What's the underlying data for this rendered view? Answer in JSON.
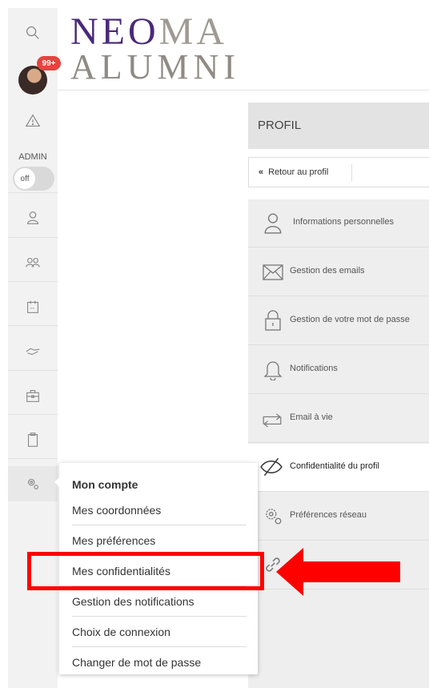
{
  "logo": {
    "line1_purple": "NE",
    "line1_o": "O",
    "line1_gray": "MA",
    "line2": "ALUMNI"
  },
  "rail": {
    "badge": "99+",
    "admin_label": "ADMIN",
    "toggle_state": "off",
    "icons": [
      "search-icon",
      "warning-icon",
      "user-icon",
      "group-icon",
      "calendar-icon",
      "handshake-icon",
      "briefcase-icon",
      "clipboard-icon",
      "settings-icon"
    ]
  },
  "profile": {
    "title": "PROFIL",
    "back_label": "Retour au profil",
    "menu": [
      {
        "label": "Informations personnelles",
        "icon": "user-icon"
      },
      {
        "label": "Gestion des emails",
        "icon": "envelope-icon"
      },
      {
        "label": "Gestion de votre mot de passe",
        "icon": "lock-icon"
      },
      {
        "label": "Notifications",
        "icon": "bell-icon"
      },
      {
        "label": "Email à vie",
        "icon": "forward-icon"
      },
      {
        "label": "Confidentialité du profil",
        "icon": "eye-slash-icon",
        "active": true
      },
      {
        "label": "Préférences réseau",
        "icon": "gear-icon"
      },
      {
        "label": "",
        "icon": "link-icon"
      }
    ]
  },
  "dropdown": {
    "heading": "Mon compte",
    "items": [
      "Mes coordonnées",
      "Mes préférences",
      "Mes confidentialités",
      "Gestion des notifications",
      "Choix de connexion",
      "Changer de mot de passe"
    ]
  },
  "annotation": {
    "color": "#ff0000",
    "highlighted_item": "Mes confidentialités"
  }
}
